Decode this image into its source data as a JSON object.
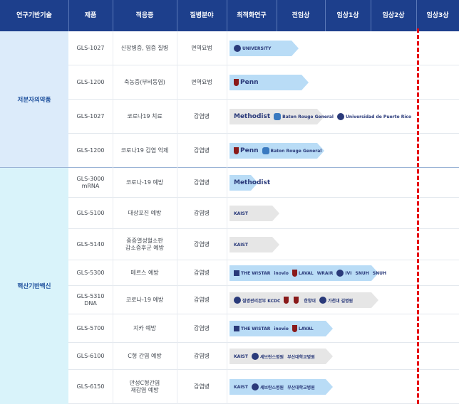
{
  "header": {
    "tech": "연구기반기술",
    "product": "제품",
    "indication": "적응증",
    "field": "질병분야",
    "optimization": "최적화연구",
    "preclinical": "전임상",
    "phase1": "임상1상",
    "phase2": "임상2상",
    "phase3": "임상3상"
  },
  "categories": [
    {
      "label": "저분자의약품",
      "bg": "#dcebfa"
    },
    {
      "label": "핵산기반백신",
      "bg": "#d9f3fa"
    }
  ],
  "rows": [
    {
      "product": "GLS-1027",
      "indication": "신장병증, 염증 질병",
      "field": "면역요법",
      "progress": 0.35,
      "style": "blue",
      "logos": [
        {
          "icon": "seal-icon",
          "text": "UNIVERSITY"
        }
      ]
    },
    {
      "product": "GLS-1200",
      "indication": "축농증(부비동염)",
      "field": "면역요법",
      "progress": 0.4,
      "style": "blue",
      "logos": [
        {
          "icon": "shield-icon",
          "text": "Penn"
        }
      ]
    },
    {
      "product": "GLS-1027",
      "indication": "코로나19 치료",
      "field": "감염병",
      "progress": 0.48,
      "style": "gray",
      "logos": [
        {
          "icon": "",
          "text": "Methodist"
        },
        {
          "icon": "heart-icon",
          "text": "Baton Rouge General"
        },
        {
          "icon": "seal-icon",
          "text": "Universidad de Puerto Rico"
        }
      ]
    },
    {
      "product": "GLS-1200",
      "indication": "코로나19 감염 억제",
      "field": "감염병",
      "progress": 0.48,
      "style": "blue",
      "logos": [
        {
          "icon": "shield-icon",
          "text": "Penn"
        },
        {
          "icon": "heart-icon",
          "text": "Baton Rouge General"
        }
      ]
    },
    {
      "product": "GLS-3000\nmRNA",
      "indication": "코로나-19 예방",
      "field": "감염병",
      "progress": 0.12,
      "style": "blue",
      "logos": [
        {
          "icon": "",
          "text": "Methodist"
        }
      ]
    },
    {
      "product": "GLS-5100",
      "indication": "대상포진 예방",
      "field": "감염병",
      "progress": 0.25,
      "style": "gray",
      "logos": [
        {
          "icon": "",
          "text": "KAIST"
        }
      ]
    },
    {
      "product": "GLS-5140",
      "indication": "중증열성혈소판\n감소증후군 예방",
      "field": "감염병",
      "progress": 0.25,
      "style": "gray",
      "logos": [
        {
          "icon": "",
          "text": "KAIST"
        }
      ]
    },
    {
      "product": "GLS-5300",
      "indication": "메르스 예방",
      "field": "감염병",
      "progress": 0.75,
      "style": "blue",
      "logos": [
        {
          "icon": "square-icon",
          "text": "THE WISTAR"
        },
        {
          "icon": "",
          "text": "inovio"
        },
        {
          "icon": "shield-icon",
          "text": "LAVAL"
        },
        {
          "icon": "",
          "text": "WRAIR"
        },
        {
          "icon": "seal-icon",
          "text": "IVI"
        },
        {
          "icon": "",
          "text": "SNUH"
        },
        {
          "icon": "",
          "text": "SNUH"
        }
      ]
    },
    {
      "product": "GLS-5310\nDNA",
      "indication": "코로나-19 예방",
      "field": "감염병",
      "progress": 0.75,
      "style": "gray",
      "logos": [
        {
          "icon": "seal-icon",
          "text": "질병관리본부 KCDC"
        },
        {
          "icon": "shield-icon",
          "text": ""
        },
        {
          "icon": "shield-icon",
          "text": ""
        },
        {
          "icon": "",
          "text": "한양대"
        },
        {
          "icon": "seal-icon",
          "text": "가천대 길병원"
        }
      ]
    },
    {
      "product": "GLS-5700",
      "indication": "지카 예방",
      "field": "감염병",
      "progress": 0.52,
      "style": "blue",
      "logos": [
        {
          "icon": "square-icon",
          "text": "THE WISTAR"
        },
        {
          "icon": "",
          "text": "inovio"
        },
        {
          "icon": "shield-icon",
          "text": "LAVAL"
        }
      ]
    },
    {
      "product": "GLS-6100",
      "indication": "C형 간염 예방",
      "field": "감염병",
      "progress": 0.52,
      "style": "gray",
      "logos": [
        {
          "icon": "",
          "text": "KAIST"
        },
        {
          "icon": "seal-icon",
          "text": "세브란스병원"
        },
        {
          "icon": "",
          "text": "부산대학교병원"
        }
      ]
    },
    {
      "product": "GLS-6150",
      "indication": "만성C형간염\n재감염 예방",
      "field": "감염병",
      "progress": 0.52,
      "style": "blue",
      "logos": [
        {
          "icon": "",
          "text": "KAIST"
        },
        {
          "icon": "seal-icon",
          "text": "세브란스병원"
        },
        {
          "icon": "",
          "text": "부산대학교병원"
        }
      ]
    }
  ],
  "colors": {
    "header_bg": "#1d3f8c",
    "arrow_blue": "#b9dcf6",
    "arrow_gray": "#e6e6e6",
    "red_line": "#e60012",
    "category_text": "#1d4f9c"
  }
}
